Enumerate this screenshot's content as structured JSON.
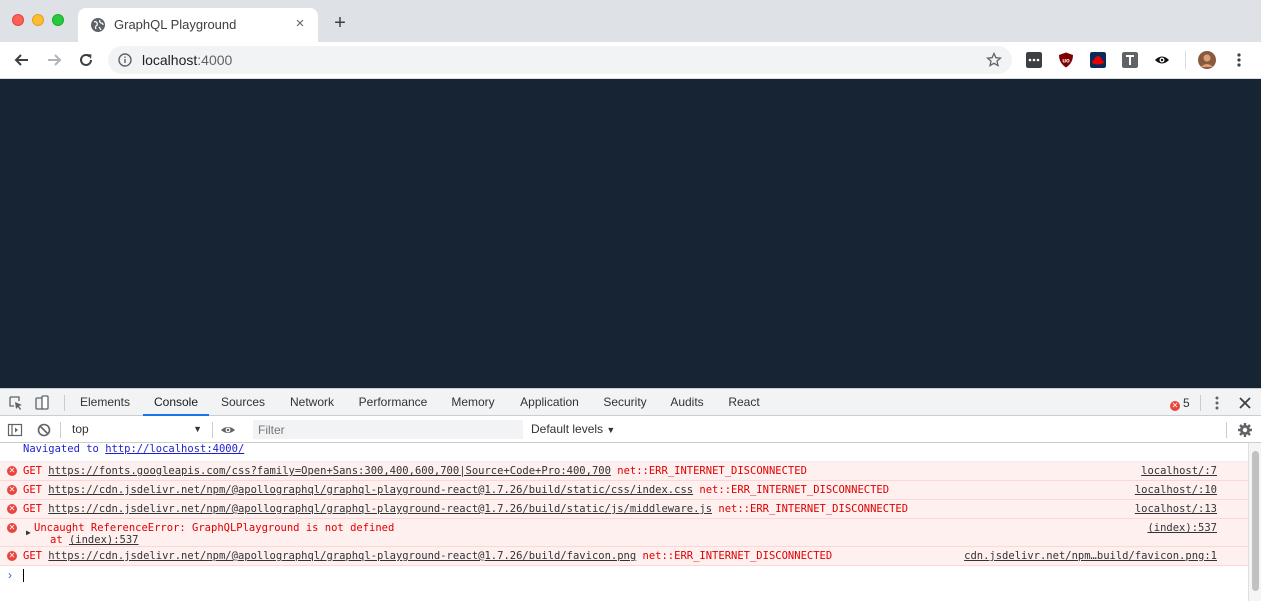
{
  "browser": {
    "tab_title": "GraphQL Playground",
    "tab_close": "×",
    "new_tab": "+",
    "url_host": "localhost",
    "url_port": ":4000"
  },
  "devtools": {
    "tabs": [
      {
        "label": "Elements"
      },
      {
        "label": "Console"
      },
      {
        "label": "Sources"
      },
      {
        "label": "Network"
      },
      {
        "label": "Performance"
      },
      {
        "label": "Memory"
      },
      {
        "label": "Application"
      },
      {
        "label": "Security"
      },
      {
        "label": "Audits"
      },
      {
        "label": "React"
      }
    ],
    "active_tab": "Console",
    "error_count": "5",
    "context": "top",
    "filter_placeholder": "Filter",
    "levels": "Default levels"
  },
  "console": {
    "navigated": {
      "prefix": "Navigated to ",
      "url": "http://localhost:4000/"
    },
    "entries": [
      {
        "method": "GET ",
        "url": "https://fonts.googleapis.com/css?family=Open+Sans:300,400,600,700|Source+Code+Pro:400,700",
        "error": " net::ERR_INTERNET_DISCONNECTED",
        "source": "localhost/:7"
      },
      {
        "method": "GET ",
        "url": "https://cdn.jsdelivr.net/npm/@apollographql/graphql-playground-react@1.7.26/build/static/css/index.css",
        "error": " net::ERR_INTERNET_DISCONNECTED",
        "source": "localhost/:10"
      },
      {
        "method": "GET ",
        "url": "https://cdn.jsdelivr.net/npm/@apollographql/graphql-playground-react@1.7.26/build/static/js/middleware.js",
        "error": " net::ERR_INTERNET_DISCONNECTED",
        "source": "localhost/:13"
      }
    ],
    "exception": {
      "text": "Uncaught ReferenceError: GraphQLPlayground is not defined",
      "at": "at ",
      "at_link": "(index):537",
      "source": "(index):537"
    },
    "last": {
      "method": "GET ",
      "url": "https://cdn.jsdelivr.net/npm/@apollographql/graphql-playground-react@1.7.26/build/favicon.png",
      "error": " net::ERR_INTERNET_DISCONNECTED",
      "source": "cdn.jsdelivr.net/npm…build/favicon.png:1"
    }
  },
  "colors": {
    "page_bg": "#172433",
    "error_text": "#e00000",
    "error_bg": "#fff0f0",
    "accent": "#1a73e8"
  }
}
